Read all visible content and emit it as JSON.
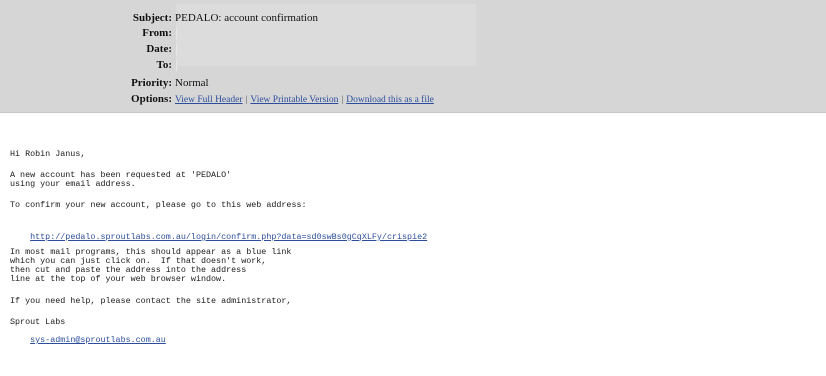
{
  "header": {
    "subject_label": "Subject:",
    "subject_value": "PEDALO: account confirmation",
    "from_label": "From:",
    "date_label": "Date:",
    "to_label": "To:",
    "priority_label": "Priority:",
    "priority_value": "Normal",
    "options_label": "Options:",
    "options": [
      "View Full Header",
      "View Printable Version",
      "Download this as a file"
    ]
  },
  "body": {
    "greeting": "Hi Robin Janus,",
    "para1_line1": "A new account has been requested at 'PEDALO'",
    "para1_line2": "using your email address.",
    "para2": "To confirm your new account, please go to this web address:",
    "confirm_link": "http://pedalo.sproutlabs.com.au/login/confirm.php?data=sd0swBs0gCqXLFy/crispie2",
    "para3_line1": "In most mail programs, this should appear as a blue link",
    "para3_line2": "which you can just click on.  If that doesn't work,",
    "para3_line3": "then cut and paste the address into the address",
    "para3_line4": "line at the top of your web browser window.",
    "para4": "If you need help, please contact the site administrator,",
    "signature_name": "Sprout Labs",
    "signature_email": "sys-admin@sproutlabs.com.au"
  },
  "colors": {
    "header_bg": "#d6d6d6",
    "link": "#2b4d9b"
  }
}
